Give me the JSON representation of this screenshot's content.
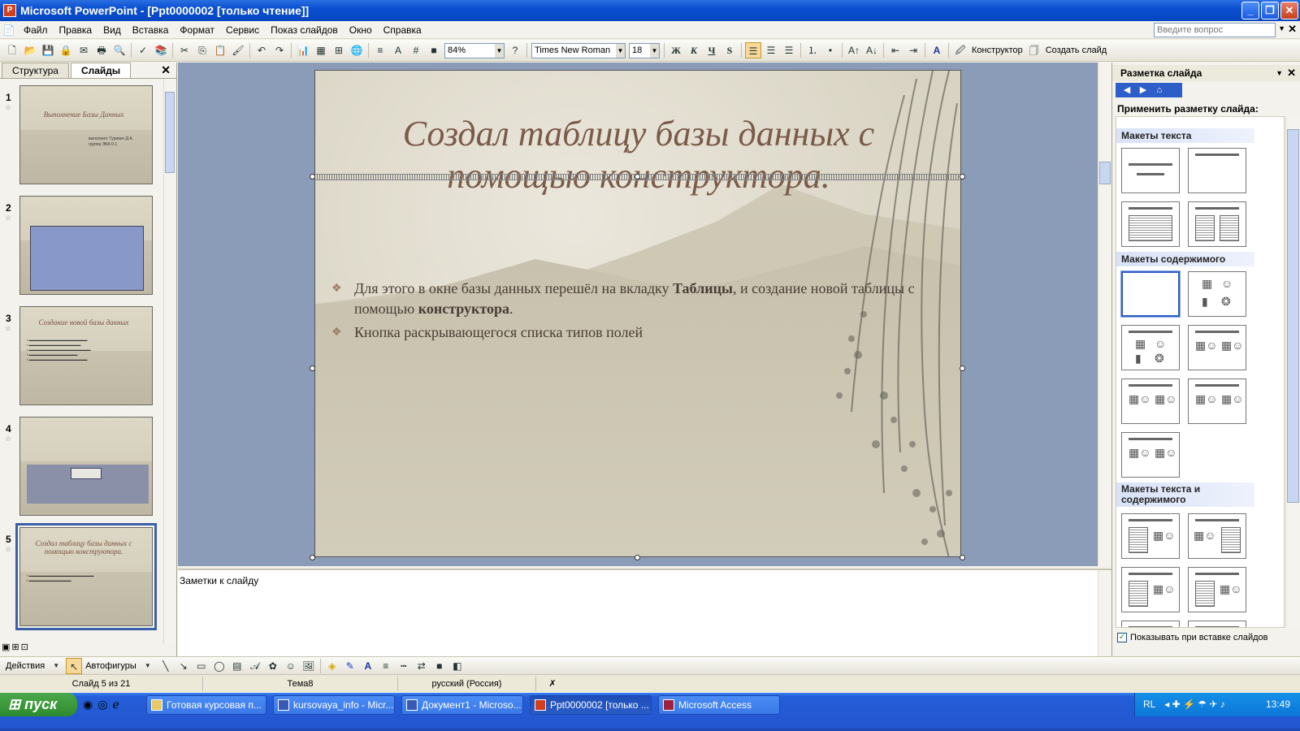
{
  "window": {
    "title": "Microsoft PowerPoint - [Ppt0000002 [только чтение]]"
  },
  "menu": {
    "items": [
      "Файл",
      "Правка",
      "Вид",
      "Вставка",
      "Формат",
      "Сервис",
      "Показ слайдов",
      "Окно",
      "Справка"
    ],
    "ask_placeholder": "Введите вопрос"
  },
  "toolbar": {
    "zoom": "84%",
    "font": "Times New Roman",
    "size": "18",
    "bold": "Ж",
    "italic": "К",
    "underline": "Ч",
    "shadow": "S",
    "designer": "Конструктор",
    "new_slide": "Создать слайд"
  },
  "leftpane": {
    "tabs": [
      "Структура",
      "Слайды"
    ],
    "thumbs": [
      {
        "num": "1",
        "title": "Выполнение Базы Данных",
        "sub": "выполнил: Гуревич Д.А.\nгруппа ЭБК-0-1"
      },
      {
        "num": "2"
      },
      {
        "num": "3",
        "title": "Создание новой базы данных"
      },
      {
        "num": "4"
      },
      {
        "num": "5",
        "title": "Создал таблицу базы данных с помощью конструктора."
      }
    ]
  },
  "slide": {
    "title": "Создал таблицу базы данных с помощью конструктора.",
    "bullets": [
      {
        "pre": "Для этого в окне базы данных перешёл на вкладку ",
        "b1": "Таблицы",
        "mid": ", и создание  новой таблицы с помощью ",
        "b2": "конструктора",
        "post": "."
      },
      {
        "pre": "Кнопка раскрывающегося списка типов полей",
        "b1": "",
        "mid": "",
        "b2": "",
        "post": ""
      }
    ]
  },
  "notes": {
    "placeholder": "Заметки к слайду"
  },
  "taskpane": {
    "title": "Разметка слайда",
    "apply": "Применить разметку слайда:",
    "sections": [
      "Макеты текста",
      "Макеты содержимого",
      "Макеты текста и содержимого"
    ],
    "checkbox": "Показывать при вставке слайдов"
  },
  "drawbar": {
    "actions": "Действия",
    "autoshapes": "Автофигуры"
  },
  "status": {
    "slide": "Слайд 5 из 21",
    "theme": "Тема8",
    "lang": "русский (Россия)"
  },
  "taskbar": {
    "start": "пуск",
    "tasks": [
      "Готовая курсовая п...",
      "kursovaya_info - Micr...",
      "Документ1 - Microso...",
      "Ppt0000002 [только ...",
      "Microsoft Access"
    ],
    "lang": "RL",
    "time": "13:49"
  }
}
